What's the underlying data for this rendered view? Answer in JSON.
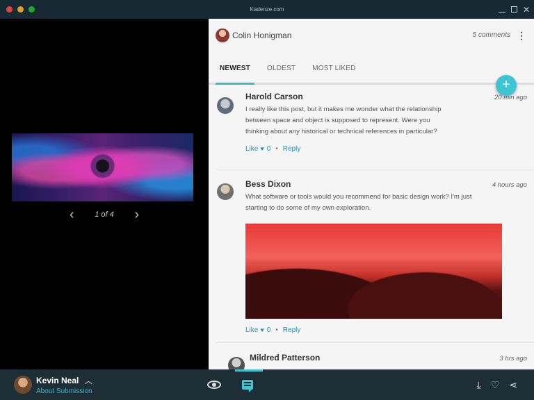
{
  "window": {
    "title": "Kadenze.com"
  },
  "viewer": {
    "pager_text": "1 of 4",
    "prev_icon": "chevron-left-icon",
    "next_icon": "chevron-right-icon"
  },
  "panel": {
    "submitter_name": "Colin Honigman",
    "comments_count": "5 comments",
    "tabs": [
      {
        "label": "NEWEST",
        "active": true
      },
      {
        "label": "OLDEST",
        "active": false
      },
      {
        "label": "MOST LIKED",
        "active": false
      }
    ],
    "fab_label": "+"
  },
  "comments": [
    {
      "author": "Harold Carson",
      "time": "20 min ago",
      "text": "I really like this post, but it makes me wonder what the relationship between space and object is supposed to represent. Were you thinking about any historical or technical references in particular?",
      "like_label": "Like",
      "likes": "0",
      "reply_label": "Reply"
    },
    {
      "author": "Bess Dixon",
      "time": "4 hours ago",
      "text": "What software or tools would you recommend for basic design work? I'm just starting to do some of my own exploration.",
      "like_label": "Like",
      "likes": "0",
      "reply_label": "Reply"
    },
    {
      "author": "Mildred Patterson",
      "time": "3 hrs ago"
    }
  ],
  "bottombar": {
    "user_name": "Kevin Neal",
    "about_link": "About Submission"
  },
  "colors": {
    "accent": "#3ec4d3",
    "bar": "#1e2e37",
    "titlebar": "#172a34"
  }
}
